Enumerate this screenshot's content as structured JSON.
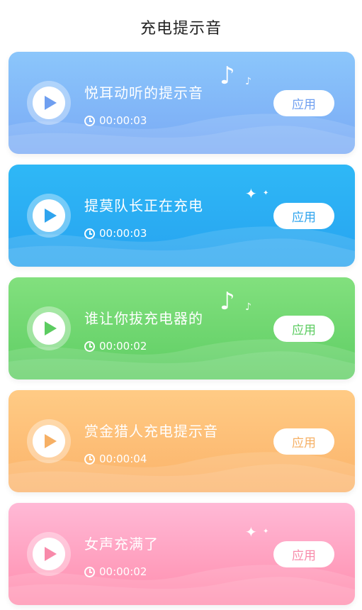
{
  "page": {
    "title": "充电提示音"
  },
  "ringtones": [
    {
      "name": "悦耳动听的提示音",
      "duration": "00:00:03",
      "apply_label": "应用",
      "decoration": "music-note",
      "color_start": "#8bc6fb",
      "color_end": "#7aaaf5",
      "accent": "#6f9ff0"
    },
    {
      "name": "提莫队长正在充电",
      "duration": "00:00:03",
      "apply_label": "应用",
      "decoration": "sparkle",
      "color_start": "#2fb8f6",
      "color_end": "#27a3f0",
      "accent": "#2fa4ee"
    },
    {
      "name": "谁让你拔充电器的",
      "duration": "00:00:02",
      "apply_label": "应用",
      "decoration": "music-note",
      "color_start": "#82e07e",
      "color_end": "#5fce64",
      "accent": "#5ccc61"
    },
    {
      "name": "赏金猎人充电提示音",
      "duration": "00:00:04",
      "apply_label": "应用",
      "decoration": "none",
      "color_start": "#ffcb85",
      "color_end": "#fbb36a",
      "accent": "#f6b065"
    },
    {
      "name": "女声充满了",
      "duration": "00:00:02",
      "apply_label": "应用",
      "decoration": "sparkle",
      "color_start": "#ffb9d6",
      "color_end": "#ff8eae",
      "accent": "#f88aaa"
    }
  ]
}
